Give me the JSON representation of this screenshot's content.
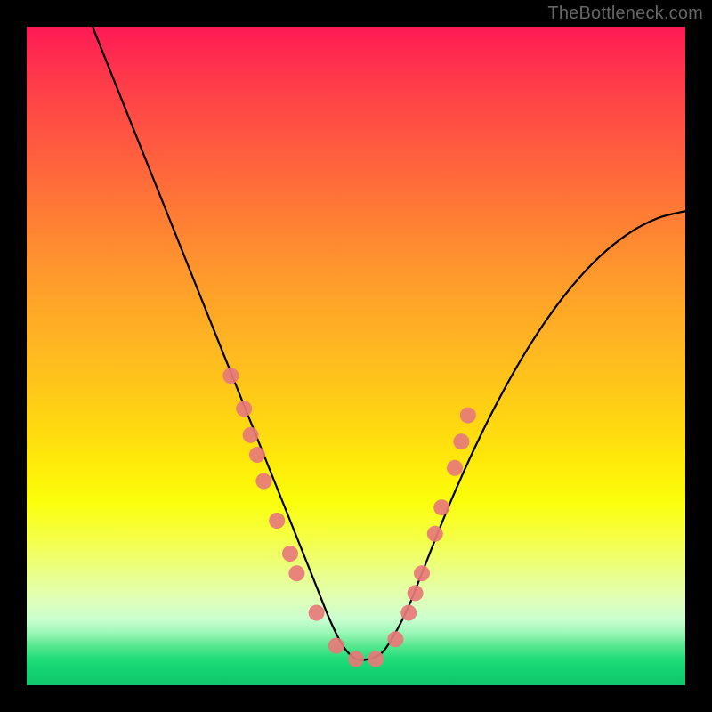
{
  "watermark": "TheBottleneck.com",
  "chart_data": {
    "type": "line",
    "title": "",
    "xlabel": "",
    "ylabel": "",
    "xlim": [
      0,
      100
    ],
    "ylim": [
      0,
      100
    ],
    "series": [
      {
        "name": "bottleneck-curve",
        "x": [
          10,
          14,
          18,
          22,
          26,
          30,
          34,
          36,
          38,
          40,
          42,
          44,
          46,
          48,
          50,
          52,
          54,
          56,
          58,
          60,
          64,
          68,
          72,
          76,
          80,
          84,
          88,
          92,
          96,
          100
        ],
        "y": [
          100,
          90,
          80,
          70,
          60,
          50,
          40,
          35,
          30,
          25,
          20,
          15,
          10,
          6,
          4,
          4,
          5,
          8,
          12,
          17,
          27,
          36,
          44,
          51,
          57,
          62,
          66,
          69,
          71,
          72
        ]
      }
    ],
    "markers": {
      "name": "highlighted-points",
      "color": "#e77a7a",
      "points": [
        {
          "x": 31,
          "y": 47
        },
        {
          "x": 33,
          "y": 42
        },
        {
          "x": 34,
          "y": 38
        },
        {
          "x": 35,
          "y": 35
        },
        {
          "x": 36,
          "y": 31
        },
        {
          "x": 38,
          "y": 25
        },
        {
          "x": 40,
          "y": 20
        },
        {
          "x": 41,
          "y": 17
        },
        {
          "x": 44,
          "y": 11
        },
        {
          "x": 47,
          "y": 6
        },
        {
          "x": 50,
          "y": 4
        },
        {
          "x": 53,
          "y": 4
        },
        {
          "x": 56,
          "y": 7
        },
        {
          "x": 58,
          "y": 11
        },
        {
          "x": 59,
          "y": 14
        },
        {
          "x": 60,
          "y": 17
        },
        {
          "x": 62,
          "y": 23
        },
        {
          "x": 63,
          "y": 27
        },
        {
          "x": 65,
          "y": 33
        },
        {
          "x": 66,
          "y": 37
        },
        {
          "x": 67,
          "y": 41
        }
      ]
    },
    "gradient_stops": [
      {
        "pos": 0,
        "color": "#ff1a55"
      },
      {
        "pos": 50,
        "color": "#ffd015"
      },
      {
        "pos": 90,
        "color": "#caffd0"
      },
      {
        "pos": 100,
        "color": "#0fc86a"
      }
    ]
  }
}
